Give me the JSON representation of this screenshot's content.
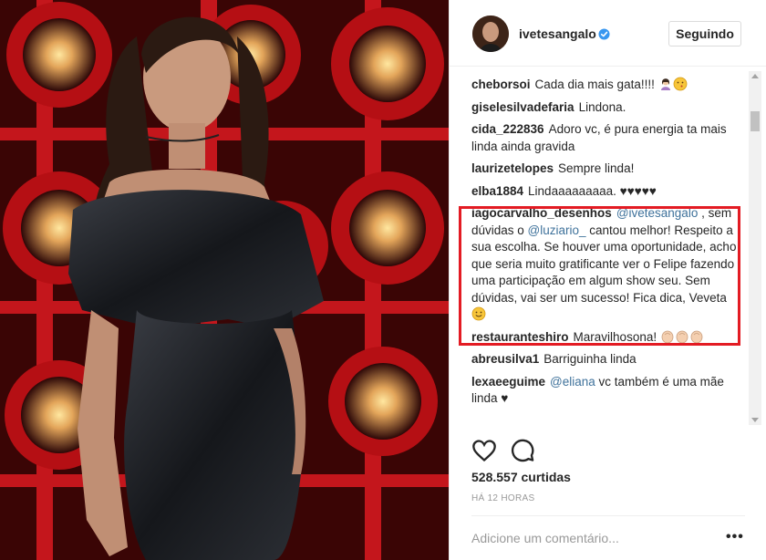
{
  "post": {
    "username": "ivetesangalo",
    "follow_label": "Seguindo",
    "likes": "528.557 curtidas",
    "time": "HÁ 12 HORAS",
    "comment_placeholder": "Adicione um comentário...",
    "more_label": "•••"
  },
  "comments": [
    {
      "user": "cheborsoi",
      "parts": [
        {
          "t": "Cada dia mais gata!!!! "
        }
      ],
      "emoji": [
        "woman-icon",
        "kiss-face-icon"
      ]
    },
    {
      "user": "giselesilvadefaria",
      "parts": [
        {
          "t": "Lindona."
        }
      ]
    },
    {
      "user": "cida_222836",
      "parts": [
        {
          "t": "Adoro vc, é pura energia ta mais linda ainda gravida"
        }
      ]
    },
    {
      "user": "laurizetelopes",
      "parts": [
        {
          "t": "Sempre linda!"
        }
      ]
    },
    {
      "user": "elba1884",
      "parts": [
        {
          "t": "Lindaaaaaaaaa. ♥♥♥♥♥"
        }
      ]
    },
    {
      "user": "iagocarvalho_desenhos",
      "parts": [
        {
          "t": "@ivetesangalo",
          "m": true
        },
        {
          "t": " , sem dúvidas o "
        },
        {
          "t": "@luziario_",
          "m": true
        },
        {
          "t": " cantou melhor! Respeito a sua escolha. Se houver uma oportunidade, acho que seria muito gratificante ver o Felipe fazendo uma participação em algum show seu. Sem dúvidas, vai ser um sucesso! Fica dica, Veveta "
        }
      ],
      "emoji": [
        "smile-face-icon"
      ]
    },
    {
      "user": "restauranteshiro",
      "parts": [
        {
          "t": "Maravilhosona! "
        }
      ],
      "emoji": [
        "clap-icon",
        "clap-icon",
        "clap-icon"
      ]
    },
    {
      "user": "abreusilva1",
      "parts": [
        {
          "t": "Barriguinha linda"
        }
      ]
    },
    {
      "user": "lexaeeguime",
      "parts": [
        {
          "t": "@eliana",
          "m": true
        },
        {
          "t": " vc também é uma mãe linda ♥"
        }
      ]
    }
  ],
  "colors": {
    "highlight": "#e31b23",
    "mention": "#3f729b",
    "verified": "#3897f0"
  },
  "icons": [
    "verified-badge-icon",
    "heart-icon",
    "comment-icon"
  ]
}
